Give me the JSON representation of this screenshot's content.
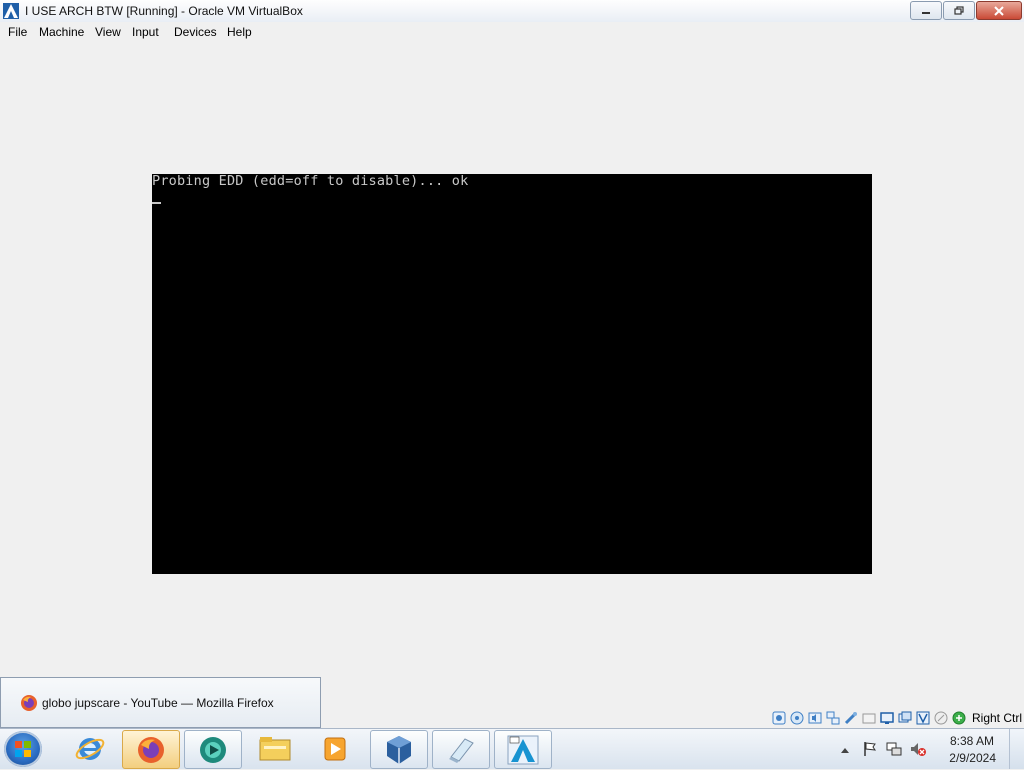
{
  "window": {
    "title": "I USE ARCH BTW [Running] - Oracle VM VirtualBox",
    "icon": "virtualbox-app-icon",
    "buttons": [
      "minimize-icon",
      "restore-icon",
      "close-icon"
    ]
  },
  "menu": {
    "items": [
      {
        "label": "File"
      },
      {
        "label": "Machine"
      },
      {
        "label": "View"
      },
      {
        "label": "Input"
      },
      {
        "label": "Devices"
      },
      {
        "label": "Help"
      }
    ]
  },
  "vm_console": {
    "line1": "Probing EDD (edd=off to disable)... ok",
    "cursor": "_"
  },
  "statusbar": {
    "icons": [
      "hard-disk-icon",
      "optical-drive-icon",
      "audio-icon",
      "network-icon",
      "usb-icon",
      "shared-folders-icon",
      "display-icon",
      "video-capture-icon",
      "cpu-virtualization-icon",
      "mouse-integration-icon",
      "keyboard-capture-icon"
    ],
    "host_key": "Right Ctrl"
  },
  "preview": {
    "icon": "firefox-icon",
    "text": "globo jupscare - YouTube — Mozilla Firefox"
  },
  "taskbar": {
    "start": "windows-start-orb",
    "apps": [
      {
        "name": "internet-explorer-icon"
      },
      {
        "name": "firefox-icon"
      },
      {
        "name": "media-app-icon"
      },
      {
        "name": "file-explorer-icon"
      },
      {
        "name": "windows-media-player-icon"
      },
      {
        "name": "virtualbox-icon"
      },
      {
        "name": "notepad-icon"
      },
      {
        "name": "arch-linux-vm-icon"
      }
    ]
  },
  "tray": {
    "time": "8:38 AM",
    "date": "2/9/2024",
    "icons": [
      "show-hidden-icons-chevron",
      "action-center-flag-icon",
      "network-icon",
      "volume-muted-icon"
    ]
  },
  "colors": {
    "vm_background": "#000000",
    "console_text": "#c8c8c8",
    "window_background": "#f0f0f0"
  }
}
